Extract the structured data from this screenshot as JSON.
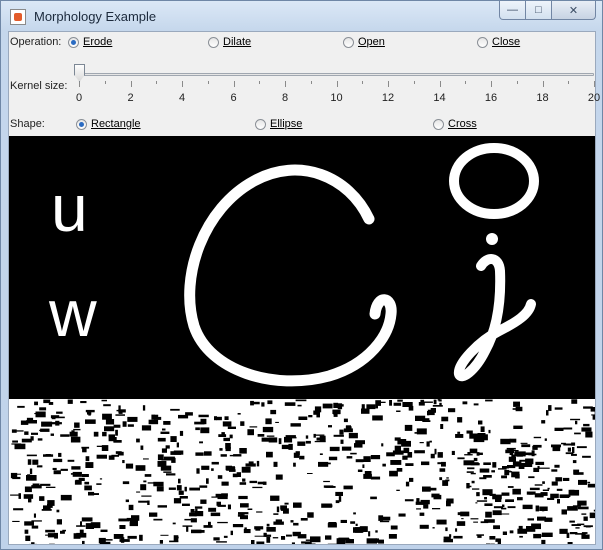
{
  "window": {
    "title": "Morphology Example",
    "min_label": "—",
    "max_label": "□",
    "close_label": "✕"
  },
  "operation": {
    "label": "Operation:",
    "options": [
      {
        "label": "Erode",
        "selected": true
      },
      {
        "label": "Dilate",
        "selected": false
      },
      {
        "label": "Open",
        "selected": false
      },
      {
        "label": "Close",
        "selected": false
      }
    ]
  },
  "kernel": {
    "label": "Kernel size:",
    "value": 0,
    "min": 0,
    "max": 20,
    "tick_labels": [
      "0",
      "2",
      "4",
      "6",
      "8",
      "10",
      "12",
      "14",
      "16",
      "18",
      "20"
    ]
  },
  "shape": {
    "label": "Shape:",
    "options": [
      {
        "label": "Rectangle",
        "selected": true
      },
      {
        "label": "Ellipse",
        "selected": false
      },
      {
        "label": "Cross",
        "selected": false
      }
    ]
  },
  "image_top": {
    "letters": [
      "u",
      "w"
    ]
  },
  "colors": {
    "radio_selected": "#2a6bc2",
    "image_bg": "#000000",
    "stroke": "#ffffff"
  }
}
